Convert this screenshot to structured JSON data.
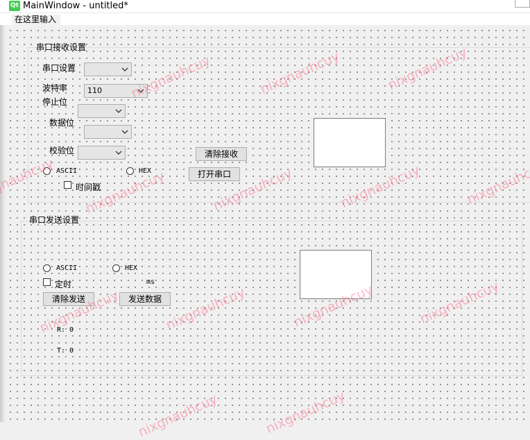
{
  "window": {
    "title": "MainWindow - untitled*",
    "logo": "Qt"
  },
  "menubar": {
    "placeholder": "在这里输入"
  },
  "receive": {
    "group_title": "串口接收设置",
    "port_label": "串口设置",
    "baud_label": "波特率",
    "baud_value": "110",
    "stopbits_label": "停止位",
    "databits_label": "数据位",
    "parity_label": "校验位",
    "clear_button": "清除接收",
    "open_button": "打开串口",
    "ascii_label": "ASCII",
    "hex_label": "HEX",
    "timestamp_label": "时间戳"
  },
  "send": {
    "group_title": "串口发送设置",
    "ascii_label": "ASCII",
    "hex_label": "HEX",
    "timer_label": "定时",
    "ms_label": "ms",
    "clear_button": "清除发送",
    "send_button": "发送数据",
    "r_label": "R: 0",
    "t_label": "T: 0"
  },
  "watermark": "nixgnauhcuy",
  "colors": {
    "watermark": "#ff466e",
    "dots": "#6e6e6e",
    "qt_green": "#41cd52"
  }
}
